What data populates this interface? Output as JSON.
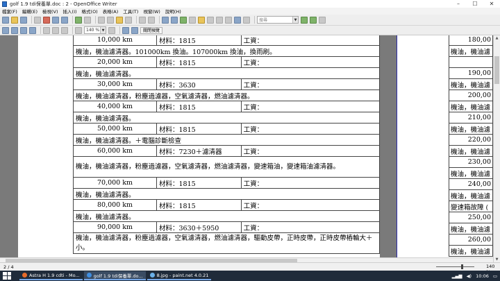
{
  "window": {
    "title": "golf 1.9 tdi保養單.doc : 2 - OpenOffice Writer",
    "minimize": "–",
    "maximize": "☐",
    "close": "✕"
  },
  "menu": [
    "檔案(F)",
    "編輯(E)",
    "檢視(V)",
    "插入(I)",
    "格式(O)",
    "表格(A)",
    "工具(T)",
    "視窗(W)",
    "說明(H)"
  ],
  "toolbar": {
    "search_placeholder": "搜尋",
    "zoom_value": "140 %",
    "preview_label": "關閉預覽"
  },
  "table_rows": [
    {
      "type": "head",
      "km": "10,000 km",
      "material": "材料：1815",
      "labor": "工資："
    },
    {
      "type": "desc",
      "text": "機油，機油濾清器。101000km 換油。107000km 換油，換雨刷。"
    },
    {
      "type": "head",
      "km": "20,000 km",
      "material": "材料：1815",
      "labor": "工資："
    },
    {
      "type": "desc",
      "text": "機油，機油濾清器。"
    },
    {
      "type": "head",
      "km": "30,000 km",
      "material": "材料：3630",
      "labor": "工資："
    },
    {
      "type": "desc",
      "text": "機油，機油濾清器，粉塵過濾器，空氣濾清器，燃油濾清器。"
    },
    {
      "type": "head",
      "km": "40,000 km",
      "material": "材料：1815",
      "labor": "工資："
    },
    {
      "type": "desc",
      "text": "機油，機油濾清器。"
    },
    {
      "type": "head",
      "km": "50,000 km",
      "material": "材料：1815",
      "labor": "工資："
    },
    {
      "type": "desc",
      "text": "機油，機油濾清器。＋電腦診斷檢查"
    },
    {
      "type": "head",
      "km": "60,000 km",
      "material": "材料：7230＋濾清器",
      "labor": "工資："
    },
    {
      "type": "desc2",
      "text": "機油，機油濾清器，粉塵過濾器，空氣濾清器，燃油濾清器，變速箱油，變速箱油濾清器。"
    },
    {
      "type": "head",
      "km": "70,000 km",
      "material": "材料：1815",
      "labor": "工資："
    },
    {
      "type": "desc",
      "text": "機油，機油濾清器。"
    },
    {
      "type": "head",
      "km": "80,000 km",
      "material": "材料：1815",
      "labor": "工資："
    },
    {
      "type": "desc",
      "text": "機油，機油濾清器。"
    },
    {
      "type": "head",
      "km": "90,000 km",
      "material": "材料：3630＋5950",
      "labor": "工資："
    },
    {
      "type": "desc2",
      "text": "機油，機油濾清器，粉塵過濾器，空氣濾清器，燃油濾清器，驅動皮帶，正時皮帶，正時皮帶樁輪大＋小。"
    }
  ],
  "right_page_rows": [
    {
      "text": "180,00",
      "num": true
    },
    {
      "text": "機油，機油濾",
      "num": false
    },
    {
      "text": "",
      "num": false,
      "blank": true
    },
    {
      "text": "190,00",
      "num": true
    },
    {
      "text": "機油，機油濾",
      "num": false
    },
    {
      "text": "200,00",
      "num": true
    },
    {
      "text": "機油，機油濾",
      "num": false
    },
    {
      "text": "210,00",
      "num": true
    },
    {
      "text": "機油，機油濾",
      "num": false
    },
    {
      "text": "220,00",
      "num": true
    },
    {
      "text": "機油，機油濾",
      "num": false
    },
    {
      "text": "230,00",
      "num": true
    },
    {
      "text": "機油，機油濾",
      "num": false
    },
    {
      "text": "240,00",
      "num": true
    },
    {
      "text": "機油，機油濾",
      "num": false
    },
    {
      "text": "變速箱故障 (",
      "num": false
    },
    {
      "text": "250,00",
      "num": true
    },
    {
      "text": "機油，機油濾",
      "num": false
    },
    {
      "text": "260,00",
      "num": true
    },
    {
      "text": "機油，機油濾",
      "num": false
    }
  ],
  "status": {
    "page": "2 / 4",
    "zoom": "140 %"
  },
  "taskbar": {
    "tasks": [
      "Astra H 1.9 cdti - Mo...",
      "golf 1.9 tdi保養單.do...",
      "8.jpg - paint.net 4.0.21"
    ],
    "clock": "10:06"
  }
}
